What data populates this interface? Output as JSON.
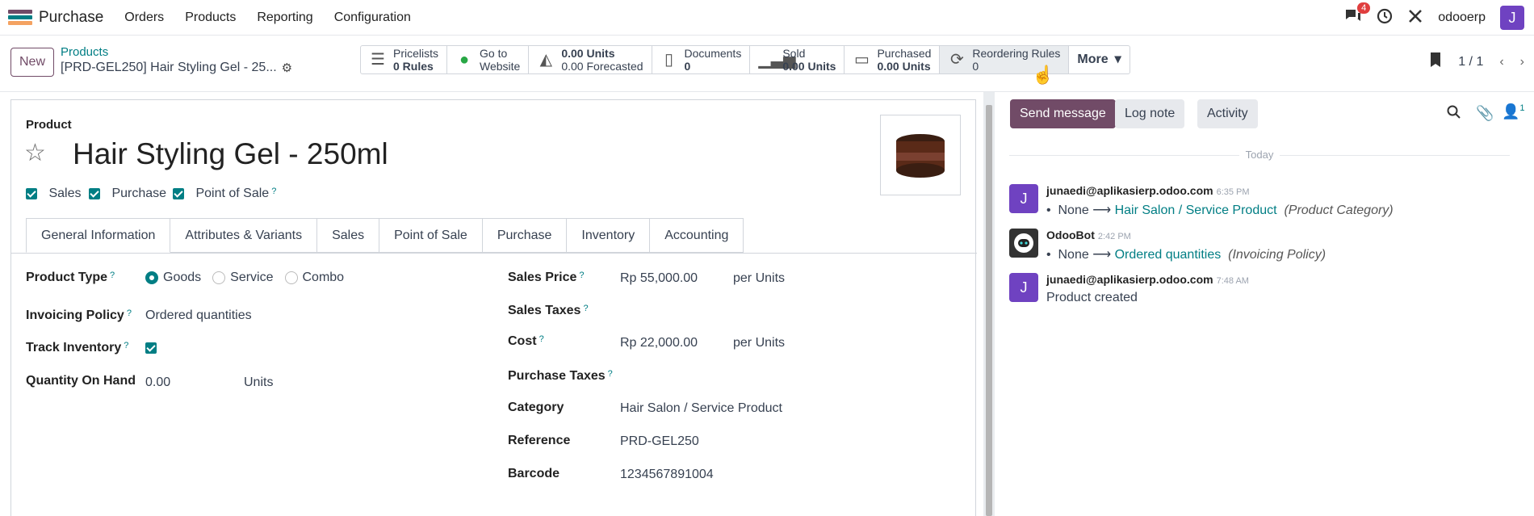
{
  "nav": {
    "app_name": "Purchase",
    "menus": [
      "Orders",
      "Products",
      "Reporting",
      "Configuration"
    ],
    "message_count": "4",
    "company": "odooerp",
    "user_initial": "J",
    "brand_colors": [
      "#714b67",
      "#017e84",
      "#f4a261"
    ]
  },
  "control": {
    "new_label": "New",
    "breadcrumb_parent": "Products",
    "breadcrumb_current": "[PRD-GEL250] Hair Styling Gel - 25...",
    "pager": "1 / 1",
    "more_label": "More"
  },
  "smart_buttons": [
    {
      "icon": "list-icon",
      "line1": "Pricelists",
      "line2": "0 Rules"
    },
    {
      "icon": "globe-icon",
      "line1": "Go to",
      "line2": "Website"
    },
    {
      "icon": "area-chart-icon",
      "line1": "0.00 Units",
      "line2": "0.00 Forecasted"
    },
    {
      "icon": "document-icon",
      "line1": "Documents",
      "line2": "0"
    },
    {
      "icon": "bar-chart-icon",
      "line1": "Sold",
      "line2": "0.00 Units"
    },
    {
      "icon": "credit-card-icon",
      "line1": "Purchased",
      "line2": "0.00 Units"
    },
    {
      "icon": "refresh-icon",
      "line1": "Reordering Rules",
      "line2": "0"
    }
  ],
  "form": {
    "kind_label": "Product",
    "title": "Hair Styling Gel - 250ml",
    "options": [
      "Sales",
      "Purchase",
      "Point of Sale"
    ],
    "tabs": [
      "General Information",
      "Attributes & Variants",
      "Sales",
      "Point of Sale",
      "Purchase",
      "Inventory",
      "Accounting"
    ],
    "product_type_label": "Product Type",
    "product_types": [
      "Goods",
      "Service",
      "Combo"
    ],
    "invoicing_policy_label": "Invoicing Policy",
    "invoicing_policy": "Ordered quantities",
    "track_inventory_label": "Track Inventory",
    "qty_label": "Quantity On Hand",
    "qty_value": "0.00",
    "qty_unit": "Units",
    "sales_price_label": "Sales Price",
    "sales_price": "Rp 55,000.00",
    "per_units": "per Units",
    "sales_taxes_label": "Sales Taxes",
    "cost_label": "Cost",
    "cost": "Rp 22,000.00",
    "purchase_taxes_label": "Purchase Taxes",
    "category_label": "Category",
    "category": "Hair Salon / Service Product",
    "reference_label": "Reference",
    "reference": "PRD-GEL250",
    "barcode_label": "Barcode",
    "barcode": "1234567891004"
  },
  "chatter": {
    "send_message": "Send message",
    "log_note": "Log note",
    "activity": "Activity",
    "follower_count": "1",
    "day_label": "Today",
    "messages": [
      {
        "author": "junaedi@aplikasierp.odoo.com",
        "time": "6:35 PM",
        "old": "None",
        "new": "Hair Salon / Service Product",
        "field": "(Product Category)",
        "initial": "J"
      },
      {
        "author": "OdooBot",
        "time": "2:42 PM",
        "old": "None",
        "new": "Ordered quantities",
        "field": "(Invoicing Policy)",
        "initial": ""
      },
      {
        "author": "junaedi@aplikasierp.odoo.com",
        "time": "7:48 AM",
        "body": "Product created",
        "initial": "J"
      }
    ]
  }
}
